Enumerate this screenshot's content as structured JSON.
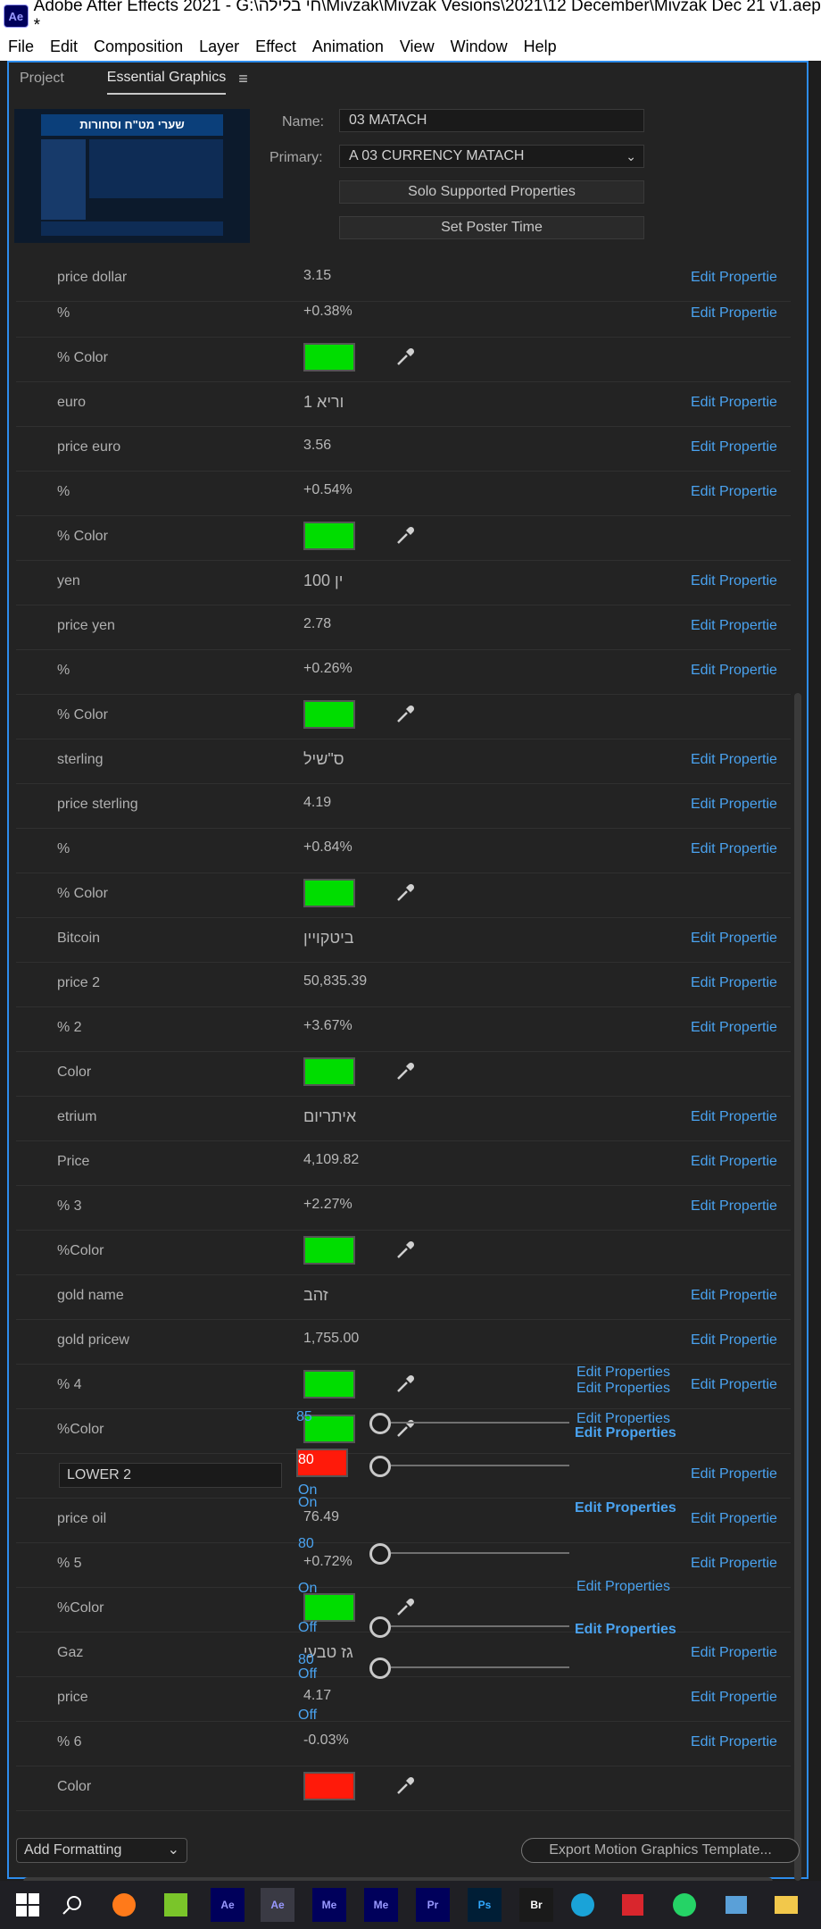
{
  "window": {
    "title": "Adobe After Effects 2021 - G:\\חי בלילה\\Mivzak\\Mivzak Vesions\\2021\\12 December\\Mivzak Dec 21 v1.aep *",
    "app_icon": "Ae"
  },
  "menu": [
    "File",
    "Edit",
    "Composition",
    "Layer",
    "Effect",
    "Animation",
    "View",
    "Window",
    "Help"
  ],
  "tabs": {
    "project": "Project",
    "essential": "Essential Graphics",
    "menu_icon": "hamburger-icon"
  },
  "thumbnail": {
    "banner": "שערי מט\"ח וסחורות"
  },
  "fields": {
    "name_label": "Name:",
    "name_value": "03 MATACH",
    "primary_label": "Primary:",
    "primary_value": "A 03 CURRENCY MATACH",
    "solo_button": "Solo Supported Properties",
    "poster_button": "Set Poster Time"
  },
  "edit_label": "Edit Propertie",
  "edit_full": "Edit Properties",
  "rows": [
    {
      "label": "price dollar",
      "value": "3.15",
      "edit": true
    },
    {
      "label": "%",
      "value": "+0.38%",
      "edit": true
    },
    {
      "label": "% Color",
      "color": "#00dd00"
    },
    {
      "label": "euro",
      "value": "1 וריא",
      "edit": true,
      "heb": true
    },
    {
      "label": "price euro",
      "value": "3.56",
      "edit": true
    },
    {
      "label": "%",
      "value": "+0.54%",
      "edit": true
    },
    {
      "label": "% Color",
      "color": "#00dd00"
    },
    {
      "label": "yen",
      "value": "100 ין",
      "edit": true,
      "heb": true
    },
    {
      "label": "price yen",
      "value": "2.78",
      "edit": true
    },
    {
      "label": "%",
      "value": "+0.26%",
      "edit": true
    },
    {
      "label": "% Color",
      "color": "#00dd00"
    },
    {
      "label": "sterling",
      "value": "ס\"שיל",
      "edit": true,
      "heb": true
    },
    {
      "label": "price sterling",
      "value": "4.19",
      "edit": true
    },
    {
      "label": "%",
      "value": "+0.84%",
      "edit": true
    },
    {
      "label": "% Color",
      "color": "#00dd00"
    },
    {
      "label": "Bitcoin",
      "value": "ביטקויין",
      "edit": true,
      "heb": true
    },
    {
      "label": "price 2",
      "value": "50,835.39",
      "edit": true
    },
    {
      "label": "% 2",
      "value": "+3.67%",
      "edit": true
    },
    {
      "label": "Color",
      "color": "#00dd00"
    },
    {
      "label": "etrium",
      "value": "איתריום",
      "edit": true,
      "heb": true
    },
    {
      "label": "Price",
      "value": "4,109.82",
      "edit": true
    },
    {
      "label": "% 3",
      "value": "+2.27%",
      "edit": true
    },
    {
      "label": "%Color",
      "color": "#00dd00"
    },
    {
      "label": "gold name",
      "value": "זהב",
      "edit": true,
      "heb": true
    },
    {
      "label": "gold pricew",
      "value": "1,755.00",
      "edit": true
    },
    {
      "label": "% 4",
      "color": "#00dd00",
      "edit": true
    },
    {
      "label": "%Color",
      "color": "#00dd00"
    },
    {
      "label": "",
      "input": "LOWER 2",
      "edit": true
    },
    {
      "label": "price oil",
      "value": "76.49",
      "edit": true
    },
    {
      "label": "% 5",
      "value": "+0.72%",
      "edit": true
    },
    {
      "label": "%Color",
      "color": "#00dd00"
    },
    {
      "label": "Gaz",
      "value": "גז טבעי",
      "edit": true,
      "heb": true
    },
    {
      "label": "price",
      "value": "4.17",
      "edit": true
    },
    {
      "label": "% 6",
      "value": "-0.03%",
      "edit": true
    },
    {
      "label": "Color",
      "color": "#ff1a0a"
    }
  ],
  "ghosts": {
    "v85": "85",
    "v80a": "80",
    "v80b": "80",
    "v80c": "80",
    "v80d": "80",
    "on1": "On",
    "on2": "On",
    "on3": "On",
    "off1": "Off",
    "off2": "Off",
    "off3": "Off",
    "overlap": "Edit Properties"
  },
  "bottom": {
    "add_formatting": "Add Formatting",
    "export": "Export Motion Graphics Template..."
  },
  "taskbar": [
    "windows-icon",
    "search-icon",
    "firefox-icon",
    "media-icon",
    "Ae",
    "Ae",
    "Me",
    "Me",
    "Pr",
    "Ps",
    "Br",
    "edge-icon",
    "download-icon",
    "whatsapp-icon",
    "window-icon",
    "folder-icon"
  ],
  "colors": {
    "accent": "#2d8ceb",
    "link": "#4aa3f0",
    "green": "#00dd00",
    "red": "#ff1a0a"
  }
}
